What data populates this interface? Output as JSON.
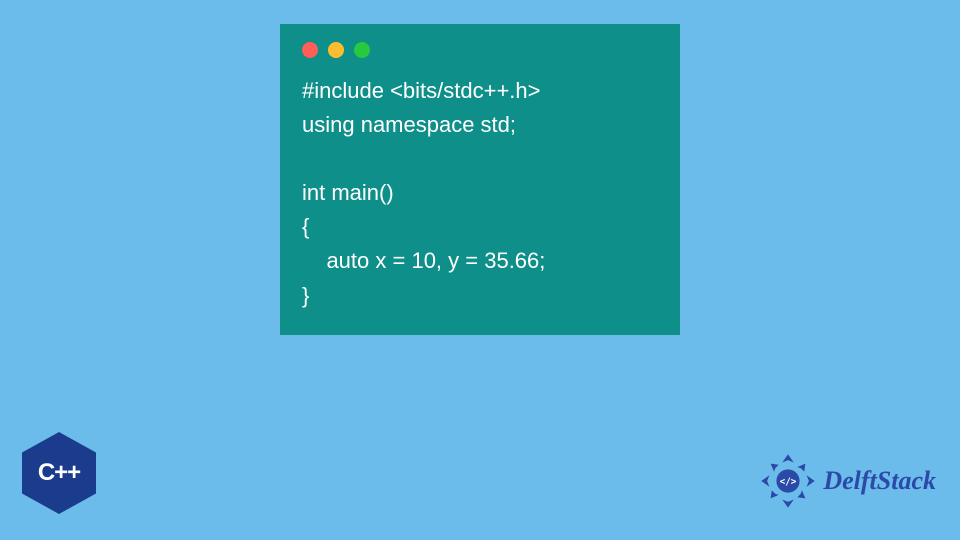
{
  "code": {
    "lines": [
      "#include <bits/stdc++.h>",
      "using namespace std;",
      "",
      "int main()",
      "{",
      "    auto x = 10, y = 35.66;",
      "}"
    ]
  },
  "badges": {
    "cpp_label": "C++",
    "brand_name": "DelftStack"
  },
  "colors": {
    "background": "#6cbceb",
    "code_window": "#0e8f8a",
    "code_text": "#ffffff",
    "cpp_hex": "#1b3c8c",
    "brand_text": "#2b4aa8",
    "dot_red": "#ff5f56",
    "dot_yellow": "#ffbd2e",
    "dot_green": "#27c93f"
  }
}
